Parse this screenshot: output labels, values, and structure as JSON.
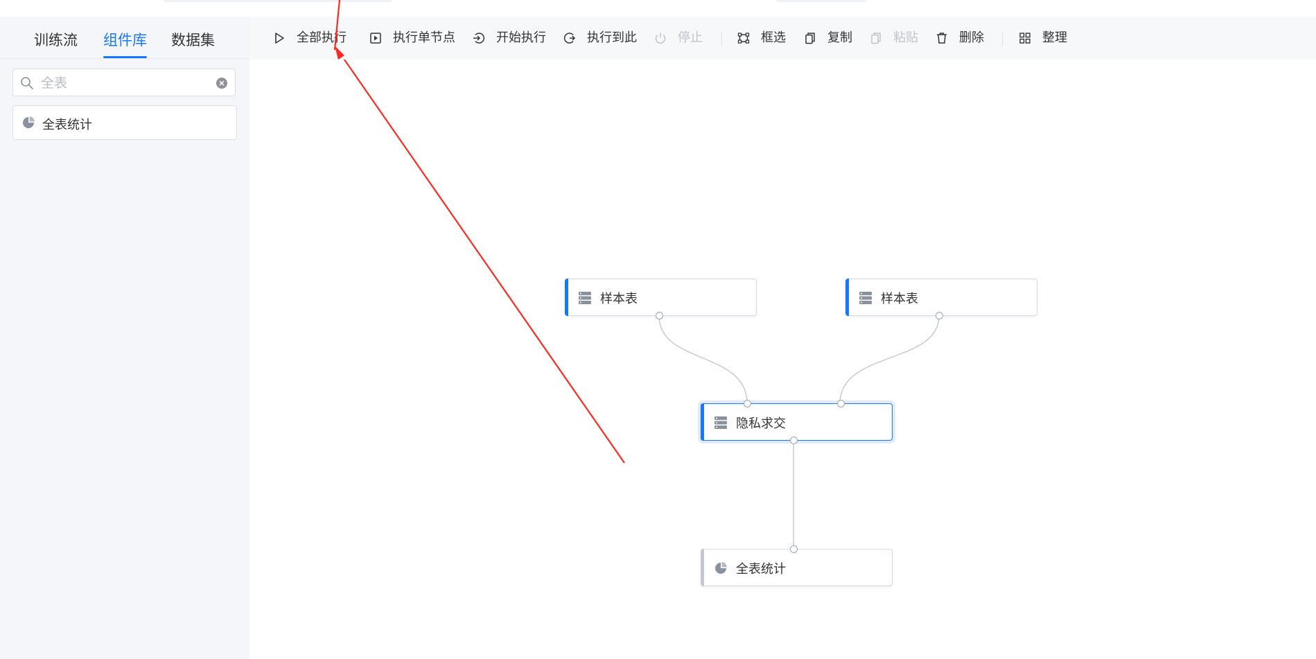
{
  "left_tabs": [
    {
      "label": "训练流"
    },
    {
      "label": "组件库"
    },
    {
      "label": "数据集"
    }
  ],
  "search": {
    "value": "",
    "placeholder": "全表"
  },
  "component_list": [
    {
      "label": "全表统计"
    }
  ],
  "toolbar": {
    "run_all": "全部执行",
    "run_single": "执行单节点",
    "start_run": "开始执行",
    "run_to_here": "执行到此",
    "stop": "停止",
    "box_select": "框选",
    "copy": "复制",
    "paste": "粘贴",
    "delete": "删除",
    "arrange": "整理"
  },
  "nodes": [
    {
      "label": "样本表"
    },
    {
      "label": "样本表"
    },
    {
      "label": "隐私求交"
    },
    {
      "label": "全表统计"
    }
  ],
  "colors": {
    "accent": "#1677ff",
    "annotation_arrow": "#ff2a1f"
  }
}
